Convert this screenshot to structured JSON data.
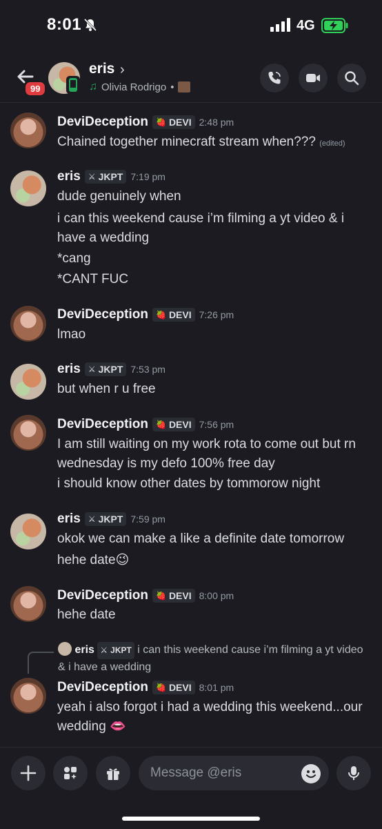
{
  "status_bar": {
    "time": "8:01",
    "network": "4G"
  },
  "header": {
    "badge": "99",
    "name": "eris",
    "chevron": "›",
    "activity": "Olivia Rodrigo",
    "activity_sep": "•"
  },
  "messages": [
    {
      "user": "DeviDeception",
      "tag": "DEVI",
      "tag_icon": "🍓",
      "time": "2:48 pm",
      "lines": [
        "Chained together minecraft stream when???"
      ],
      "edited": "(edited)"
    },
    {
      "user": "eris",
      "tag": "JKPT",
      "tag_icon": "⚔",
      "time": "7:19 pm",
      "lines": [
        "dude genuinely when",
        "i can this weekend cause i’m filming a yt video & i have a wedding",
        "*cang",
        "*CANT FUC"
      ]
    },
    {
      "user": "DeviDeception",
      "tag": "DEVI",
      "tag_icon": "🍓",
      "time": "7:26 pm",
      "lines": [
        "lmao"
      ]
    },
    {
      "user": "eris",
      "tag": "JKPT",
      "tag_icon": "⚔",
      "time": "7:53 pm",
      "lines": [
        "but when r u free"
      ]
    },
    {
      "user": "DeviDeception",
      "tag": "DEVI",
      "tag_icon": "🍓",
      "time": "7:56 pm",
      "lines": [
        "I am still waiting on my work rota to come out but rn wednesday is my defo 100% free day",
        "i should know other dates by tommorow night"
      ]
    },
    {
      "user": "eris",
      "tag": "JKPT",
      "tag_icon": "⚔",
      "time": "7:59 pm",
      "lines": [
        "okok we can make a like a definite date tomorrow",
        "hehe date😉"
      ]
    },
    {
      "user": "DeviDeception",
      "tag": "DEVI",
      "tag_icon": "🍓",
      "time": "8:00 pm",
      "lines": [
        "hehe date"
      ]
    },
    {
      "user": "DeviDeception",
      "tag": "DEVI",
      "tag_icon": "🍓",
      "time": "8:01 pm",
      "lines": [
        "yeah i also forgot i had a wedding this weekend...our wedding 👄"
      ]
    }
  ],
  "reply_preview": {
    "user": "eris",
    "tag": "JKPT",
    "tag_icon": "⚔",
    "text": "i can this weekend cause i’m filming a yt video & i have a wedding"
  },
  "composer": {
    "placeholder": "Message @eris"
  },
  "icons": {
    "back": "arrow-left-icon",
    "call": "phone-icon",
    "video": "video-camera-icon",
    "search": "search-icon",
    "plus": "plus-icon",
    "apps": "apps-icon",
    "gift": "gift-icon",
    "emoji": "emoji-icon",
    "mic": "microphone-icon"
  },
  "colors": {
    "background": "#1b1b21",
    "badge": "#e03c3f",
    "online_mobile": "#23a55a",
    "battery": "#30d158"
  }
}
